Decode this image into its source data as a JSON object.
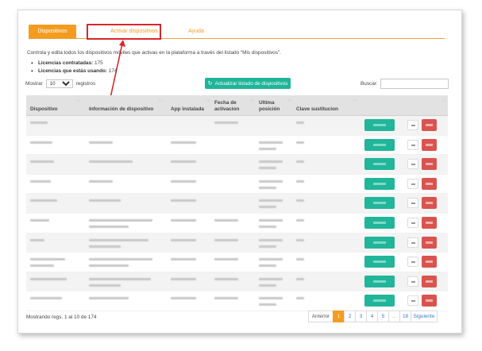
{
  "tabs": [
    {
      "label": "Dispositivos",
      "active": true
    },
    {
      "label": "Activar dispositivos",
      "active": false
    },
    {
      "label": "Ayuda",
      "active": false
    }
  ],
  "description": "Controla y edita todos los dispositivos móviles que activas en la plataforma a través del listado \"Mis dispositivos\".",
  "licenses": {
    "contracted_label": "Licencias contratadas:",
    "contracted_value": "175",
    "in_use_label": "Licencias que estás usando:",
    "in_use_value": "174"
  },
  "controls": {
    "show_label": "Mostrar",
    "show_value": "10",
    "records_label": "registros",
    "refresh_label": "Actualizar listado de dispositivos",
    "search_label": "Buscar:",
    "search_value": ""
  },
  "table": {
    "columns": [
      "Dispositivo",
      "Información de dispositivo",
      "App instalada",
      "Fecha de activacion",
      "Ultima posición",
      "Clave sustitucion"
    ],
    "row_count": 10
  },
  "footer": {
    "info": "Mostrando regs. 1 al 10 de 174",
    "prev": "Anterior",
    "pages": [
      "1",
      "2",
      "3",
      "4",
      "5",
      "...",
      "18"
    ],
    "current_page": "1",
    "next": "Siguiente"
  },
  "colors": {
    "accent": "#f39c1f",
    "primary_button": "#1fb59a",
    "danger_button": "#d9534f",
    "highlight": "#d9262b"
  }
}
